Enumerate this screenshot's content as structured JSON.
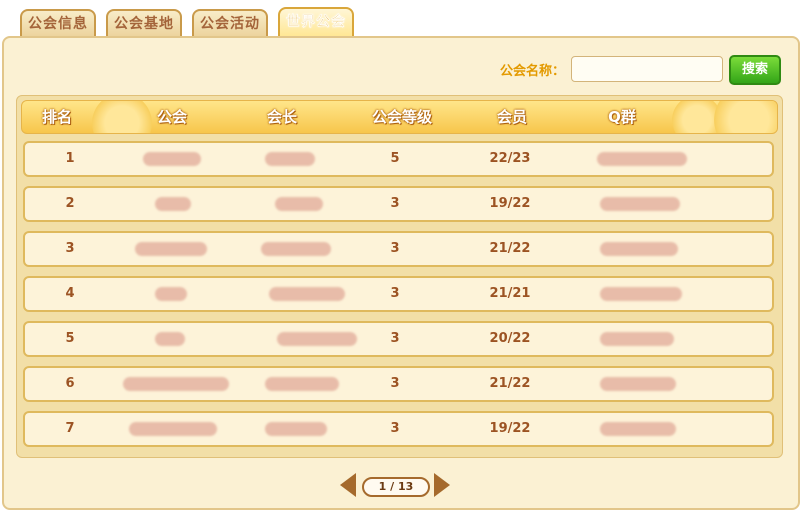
{
  "tabs": [
    {
      "label": "公会信息",
      "active": false
    },
    {
      "label": "公会基地",
      "active": false
    },
    {
      "label": "公会活动",
      "active": false
    },
    {
      "label": "世界公会",
      "active": true
    }
  ],
  "search": {
    "label": "公会名称：",
    "value": "",
    "button": "搜索"
  },
  "table": {
    "headers": [
      "排名",
      "公会",
      "会长",
      "公会等级",
      "会员",
      "Q群"
    ],
    "rows": [
      {
        "rank": "1",
        "level": "5",
        "members": "22/23"
      },
      {
        "rank": "2",
        "level": "3",
        "members": "19/22"
      },
      {
        "rank": "3",
        "level": "3",
        "members": "21/22"
      },
      {
        "rank": "4",
        "level": "3",
        "members": "21/21"
      },
      {
        "rank": "5",
        "level": "3",
        "members": "20/22"
      },
      {
        "rank": "6",
        "level": "3",
        "members": "21/22"
      },
      {
        "rank": "7",
        "level": "3",
        "members": "19/22"
      }
    ]
  },
  "pager": {
    "text": "1 / 13"
  },
  "colors": {
    "accent": "#e39a00",
    "button_green": "#33a518",
    "text_brown": "#9c5323"
  }
}
